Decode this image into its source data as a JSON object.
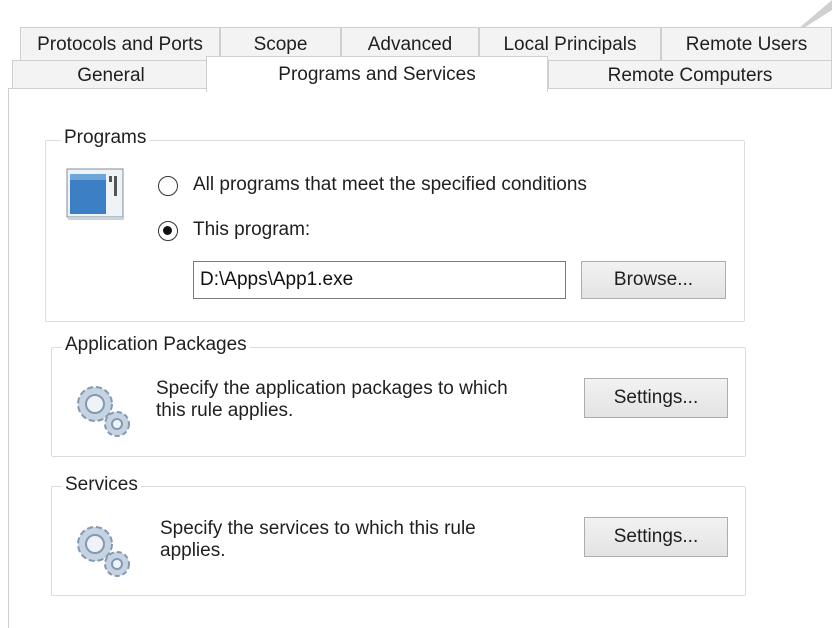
{
  "tabs": {
    "row1": [
      "Protocols and Ports",
      "Scope",
      "Advanced",
      "Local Principals",
      "Remote Users"
    ],
    "row2": [
      "General",
      "Programs and Services",
      "Remote Computers"
    ],
    "active": "Programs and Services"
  },
  "programs": {
    "title": "Programs",
    "option_all": "All programs that meet the specified conditions",
    "option_this": "This program:",
    "selected": "This program:",
    "path_value": "D:\\Apps\\App1.exe",
    "browse_label": "Browse..."
  },
  "app_packages": {
    "title": "Application Packages",
    "description_line1": "Specify the application packages to which",
    "description_line2": "this rule applies.",
    "settings_label": "Settings..."
  },
  "services": {
    "title": "Services",
    "description_line1": "Specify the services to which this rule",
    "description_line2": "applies.",
    "settings_label": "Settings..."
  }
}
